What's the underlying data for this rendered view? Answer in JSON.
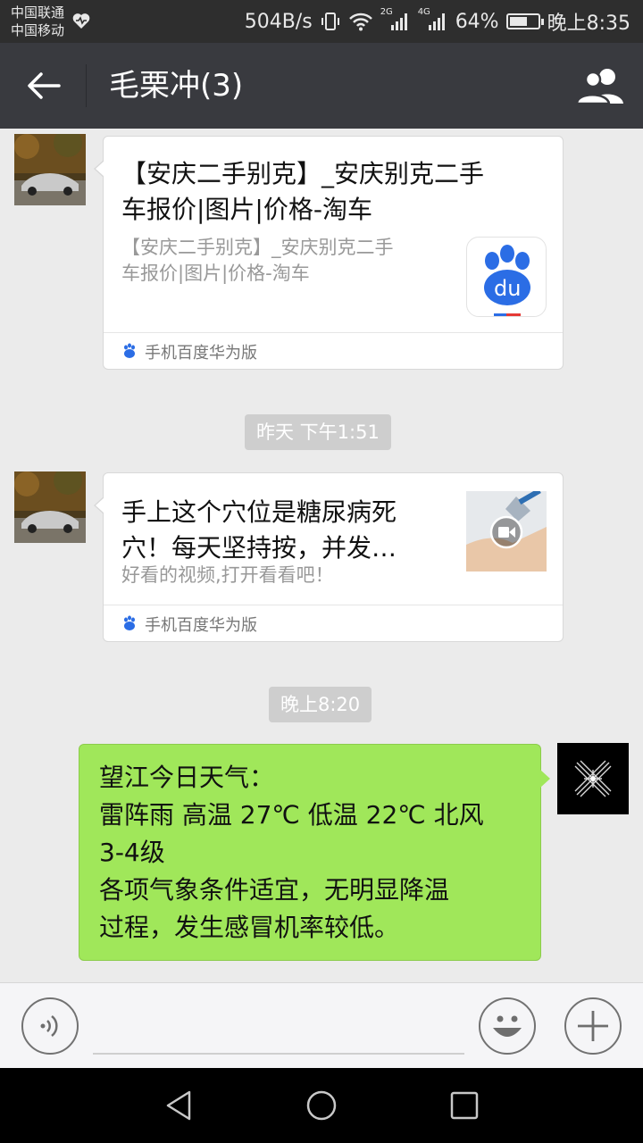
{
  "status_bar": {
    "carrier_1": "中国联通",
    "carrier_2": "中国移动",
    "net_speed": "504B/s",
    "signal_1": "2G",
    "signal_2": "4G",
    "battery_percent": "64%",
    "battery_level": 0.64,
    "time": "晚上8:35"
  },
  "title_bar": {
    "title": "毛栗冲(3)"
  },
  "messages": [
    {
      "type": "link_card",
      "title_lines": [
        "【安庆二手别克】_安庆别克二手",
        "车报价|图片|价格-淘车"
      ],
      "desc_lines": [
        "【安庆二手别克】_安庆别克二手",
        "车报价|图片|价格-淘车"
      ],
      "thumb_text": "du",
      "source": "手机百度华为版"
    },
    {
      "type": "timestamp",
      "text": "昨天 下午1:51"
    },
    {
      "type": "link_card",
      "title_lines": [
        "手上这个穴位是糖尿病死",
        "穴！每天坚持按，并发…"
      ],
      "desc_lines": [
        "好看的视频,打开看看吧！"
      ],
      "source": "手机百度华为版"
    },
    {
      "type": "timestamp",
      "text": "晚上8:20"
    },
    {
      "type": "text_sent",
      "lines": [
        "望江今日天气：",
        "雷阵雨 高温 27℃ 低温 22℃ 北风",
        "3-4级",
        "各项气象条件适宜，无明显降温",
        "过程，发生感冒机率较低。"
      ]
    }
  ],
  "colors": {
    "title_bar": "#393a3f",
    "status_bar": "#2e2e2e",
    "chat_bg": "#ebebeb",
    "sent_bubble": "#a0e75a",
    "baidu_blue": "#2b6de5"
  }
}
